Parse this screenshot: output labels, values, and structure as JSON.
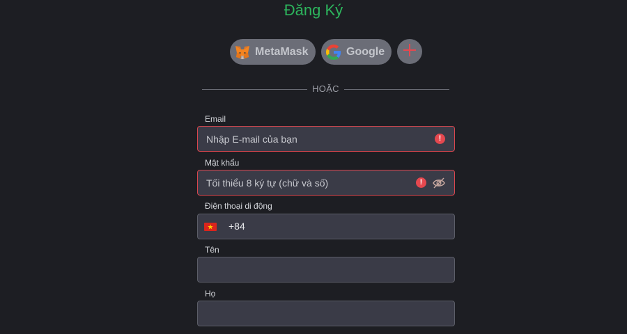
{
  "page": {
    "title": "Đăng Ký",
    "title_color": "#2db55d"
  },
  "social": {
    "metamask_label": "MetaMask",
    "google_label": "Google",
    "more_icon": "plus-icon"
  },
  "divider_text": "HOẶC",
  "form": {
    "email": {
      "label": "Email",
      "placeholder": "Nhập E-mail của bạn",
      "value": "",
      "error": true
    },
    "password": {
      "label": "Mật khẩu",
      "placeholder": "Tối thiểu 8 ký tự (chữ và số)",
      "value": "",
      "error": true
    },
    "phone": {
      "label": "Điện thoại di động",
      "country_code": "+84",
      "flag": "vietnam-flag-icon",
      "value": ""
    },
    "first_name": {
      "label": "Tên",
      "value": ""
    },
    "last_name": {
      "label": "Họ",
      "value": ""
    }
  },
  "colors": {
    "background": "#1d1e23",
    "input_bg": "#3a3b47",
    "error": "#e5484f",
    "button_bg": "#6b6d77"
  }
}
